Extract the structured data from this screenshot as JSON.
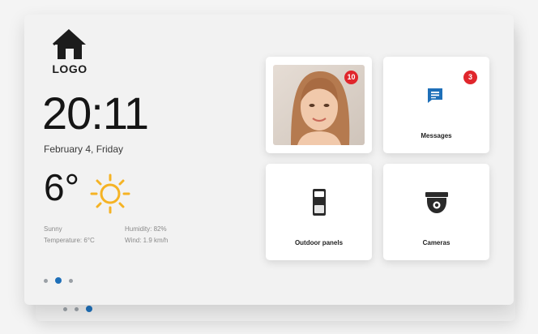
{
  "logo": {
    "text": "LOGO",
    "icon": "house-icon"
  },
  "clock": {
    "time": "20:11",
    "date": "February 4, Friday"
  },
  "weather": {
    "temperature": "6°",
    "icon": "sun-icon",
    "condition": "Sunny",
    "humidity": "Humidity: 82%",
    "feels_like": "Temperature: 6°C",
    "wind": "Wind: 1.9 km/h"
  },
  "pager": {
    "pages": 3,
    "active": 1
  },
  "tiles": {
    "intercom": {
      "badge": "10",
      "icon": "caller-photo"
    },
    "messages": {
      "label": "Messages",
      "badge": "3",
      "icon": "message-icon"
    },
    "outdoor": {
      "label": "Outdoor panels",
      "icon": "outdoor-panel-icon"
    },
    "cameras": {
      "label": "Cameras",
      "icon": "dome-camera-icon"
    }
  },
  "colors": {
    "accent": "#1e6fb8",
    "badge": "#e0262c",
    "sun": "#f5b324"
  }
}
